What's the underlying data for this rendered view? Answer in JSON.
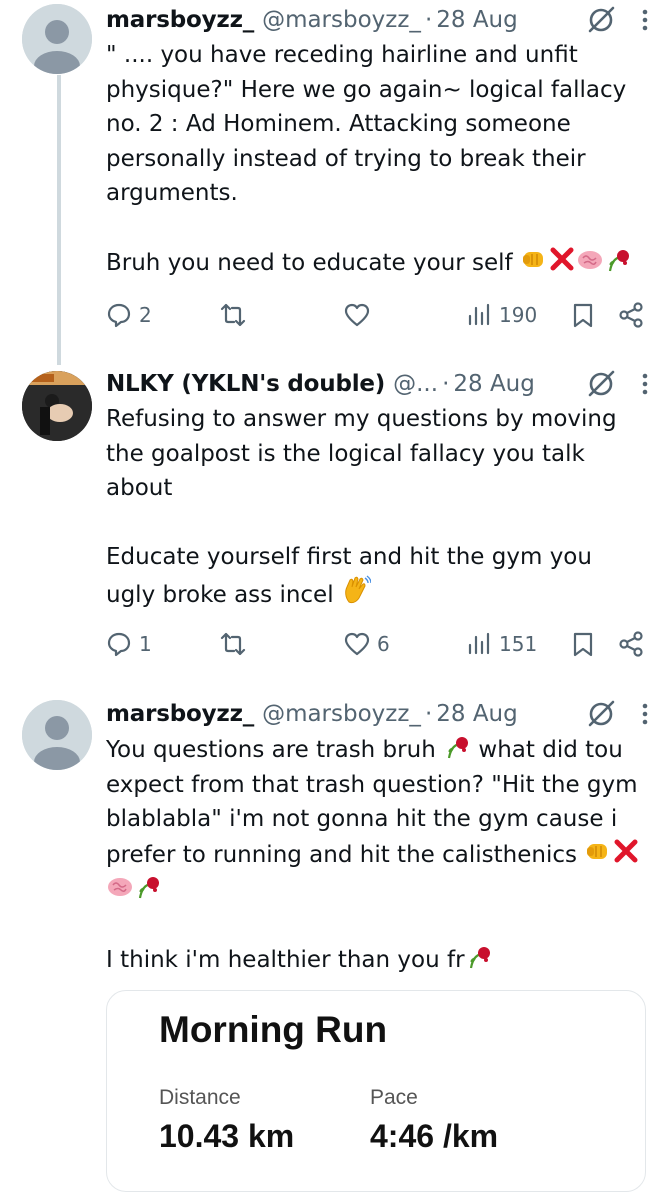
{
  "colors": {
    "text": "#0f1419",
    "muted": "#536471",
    "thread_line": "#cfd9de",
    "divider": "#e3e7ea"
  },
  "tweets": [
    {
      "display_name": "marsboyzz_",
      "handle": "@marsboyzz_",
      "dot": "·",
      "time": "28 Aug",
      "avatar": "default-avatar",
      "paragraphs": [
        "\" .... you have receding hairline and unfit physique?\" Here we go again~ logical fallacy no. 2 : Ad Hominem. Attacking someone personally instead of trying to break their arguments.",
        "Bruh you need to educate your self"
      ],
      "emojis": [
        "fist-bump-emoji",
        "cross-mark-emoji",
        "brain-emoji",
        "wilted-rose-emoji"
      ],
      "replies": "2",
      "reposts": "",
      "likes": "",
      "views": "190"
    },
    {
      "display_name": "NLKY (YKLN's double)",
      "handle": "@...",
      "dot": "·",
      "time": "28 Aug",
      "avatar": "photo-avatar",
      "paragraphs": [
        "Refusing to answer my questions by moving the goalpost is the logical fallacy you talk about",
        "Educate yourself first and hit the gym you ugly broke ass incel"
      ],
      "emojis": [
        "waving-hand-emoji"
      ],
      "replies": "1",
      "reposts": "",
      "likes": "6",
      "views": "151"
    },
    {
      "display_name": "marsboyzz_",
      "handle": "@marsboyzz_",
      "dot": "·",
      "time": "28 Aug",
      "avatar": "default-avatar",
      "paragraphs": [
        "You questions are trash bruh",
        "what did tou expect from that trash question? \"Hit the gym blablabla\" i'm not gonna hit the gym cause i prefer to running and hit the calisthenics",
        "I think i'm healthier than you fr"
      ],
      "card": {
        "title": "Morning Run",
        "stats": [
          {
            "label": "Distance",
            "value": "10.43 km"
          },
          {
            "label": "Pace",
            "value": "4:46 /km"
          }
        ]
      }
    }
  ]
}
